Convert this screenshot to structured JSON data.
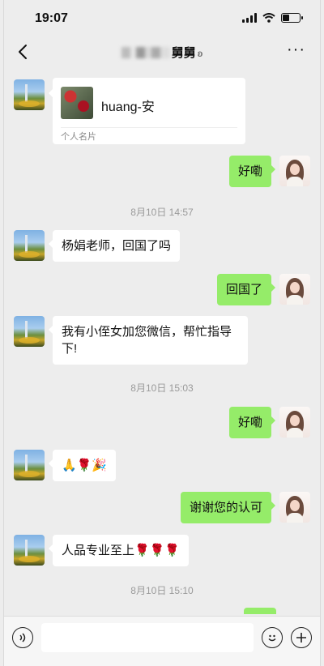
{
  "status_bar": {
    "time": "19:07",
    "battery_level": 0.4
  },
  "nav": {
    "title_suffix": "舅舅",
    "icons": [
      "chevron-left-icon",
      "ear-icon",
      "more-dots-icon"
    ]
  },
  "card": {
    "name": "huang-安",
    "type_label": "个人名片"
  },
  "messages": [
    {
      "side": "out",
      "text": "好嘞"
    },
    {
      "timestamp": "8月10日 14:57"
    },
    {
      "side": "in",
      "text": "杨娟老师，回国了吗"
    },
    {
      "side": "out",
      "text": "回国了"
    },
    {
      "side": "in",
      "text": "我有小侄女加您微信，帮忙指导下!"
    },
    {
      "timestamp": "8月10日 15:03"
    },
    {
      "side": "out",
      "text": "好嘞"
    },
    {
      "side": "in",
      "text": "🙏🌹🎉"
    },
    {
      "side": "out",
      "text": "谢谢您的认可"
    },
    {
      "side": "in",
      "text": "人品专业至上🌹🌹🌹"
    },
    {
      "timestamp": "8月10日 15:10"
    }
  ],
  "colors": {
    "background": "#ededed",
    "bubble_out": "#95ec69",
    "bubble_in": "#ffffff"
  }
}
